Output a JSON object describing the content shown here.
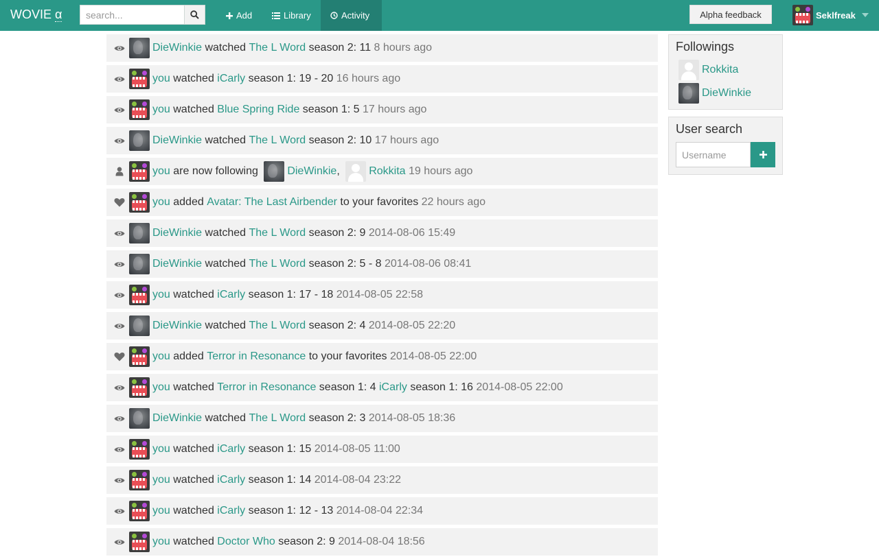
{
  "nav": {
    "brand": "WOVIE",
    "brand_alpha": "α",
    "search_placeholder": "search...",
    "add_label": "Add",
    "library_label": "Library",
    "activity_label": "Activity",
    "feedback_label": "Alpha feedback",
    "username": "Seklfreak"
  },
  "colors": {
    "accent": "#2a9888",
    "accent_dark": "#237f73",
    "row_bg": "#f2f2f2",
    "time": "#777777"
  },
  "feed": [
    {
      "icon": "eye-icon",
      "avatar": "winkie",
      "segs": [
        {
          "t": "DieWinkie",
          "l": true
        },
        {
          "t": " watched "
        },
        {
          "t": "The L Word",
          "l": true
        },
        {
          "t": " season 2: 11 "
        },
        {
          "t": "8 hours ago",
          "time": true
        }
      ]
    },
    {
      "icon": "eye-icon",
      "avatar": "monster",
      "segs": [
        {
          "t": "you",
          "l": true
        },
        {
          "t": " watched "
        },
        {
          "t": "iCarly",
          "l": true
        },
        {
          "t": " season 1: 19 - 20 "
        },
        {
          "t": "16 hours ago",
          "time": true
        }
      ]
    },
    {
      "icon": "eye-icon",
      "avatar": "monster",
      "segs": [
        {
          "t": "you",
          "l": true
        },
        {
          "t": " watched "
        },
        {
          "t": "Blue Spring Ride",
          "l": true
        },
        {
          "t": " season 1: 5 "
        },
        {
          "t": "17 hours ago",
          "time": true
        }
      ]
    },
    {
      "icon": "eye-icon",
      "avatar": "winkie",
      "segs": [
        {
          "t": "DieWinkie",
          "l": true
        },
        {
          "t": " watched "
        },
        {
          "t": "The L Word",
          "l": true
        },
        {
          "t": " season 2: 10 "
        },
        {
          "t": "17 hours ago",
          "time": true
        }
      ]
    },
    {
      "icon": "user-icon",
      "avatar": "monster",
      "segs": [
        {
          "t": "you",
          "l": true
        },
        {
          "t": " are now following "
        },
        {
          "av": "winkie"
        },
        {
          "t": "DieWinkie",
          "l": true
        },
        {
          "t": ", "
        },
        {
          "av": "default"
        },
        {
          "t": "Rokkita",
          "l": true
        },
        {
          "t": " "
        },
        {
          "t": "19 hours ago",
          "time": true
        }
      ]
    },
    {
      "icon": "heart-icon",
      "avatar": "monster",
      "segs": [
        {
          "t": "you",
          "l": true
        },
        {
          "t": " added "
        },
        {
          "t": "Avatar: The Last Airbender",
          "l": true
        },
        {
          "t": " to your favorites "
        },
        {
          "t": "22 hours ago",
          "time": true
        }
      ]
    },
    {
      "icon": "eye-icon",
      "avatar": "winkie",
      "segs": [
        {
          "t": "DieWinkie",
          "l": true
        },
        {
          "t": " watched "
        },
        {
          "t": "The L Word",
          "l": true
        },
        {
          "t": " season 2: 9 "
        },
        {
          "t": "2014-08-06 15:49",
          "time": true
        }
      ]
    },
    {
      "icon": "eye-icon",
      "avatar": "winkie",
      "segs": [
        {
          "t": "DieWinkie",
          "l": true
        },
        {
          "t": " watched "
        },
        {
          "t": "The L Word",
          "l": true
        },
        {
          "t": " season 2: 5 - 8 "
        },
        {
          "t": "2014-08-06 08:41",
          "time": true
        }
      ]
    },
    {
      "icon": "eye-icon",
      "avatar": "monster",
      "segs": [
        {
          "t": "you",
          "l": true
        },
        {
          "t": " watched "
        },
        {
          "t": "iCarly",
          "l": true
        },
        {
          "t": " season 1: 17 - 18 "
        },
        {
          "t": "2014-08-05 22:58",
          "time": true
        }
      ]
    },
    {
      "icon": "eye-icon",
      "avatar": "winkie",
      "segs": [
        {
          "t": "DieWinkie",
          "l": true
        },
        {
          "t": " watched "
        },
        {
          "t": "The L Word",
          "l": true
        },
        {
          "t": " season 2: 4 "
        },
        {
          "t": "2014-08-05 22:20",
          "time": true
        }
      ]
    },
    {
      "icon": "heart-icon",
      "avatar": "monster",
      "segs": [
        {
          "t": "you",
          "l": true
        },
        {
          "t": " added "
        },
        {
          "t": "Terror in Resonance",
          "l": true
        },
        {
          "t": " to your favorites "
        },
        {
          "t": "2014-08-05 22:00",
          "time": true
        }
      ]
    },
    {
      "icon": "eye-icon",
      "avatar": "monster",
      "segs": [
        {
          "t": "you",
          "l": true
        },
        {
          "t": " watched "
        },
        {
          "t": "Terror in Resonance",
          "l": true
        },
        {
          "t": " season 1: 4 "
        },
        {
          "t": "iCarly",
          "l": true
        },
        {
          "t": " season 1: 16 "
        },
        {
          "t": "2014-08-05 22:00",
          "time": true
        }
      ]
    },
    {
      "icon": "eye-icon",
      "avatar": "winkie",
      "segs": [
        {
          "t": "DieWinkie",
          "l": true
        },
        {
          "t": " watched "
        },
        {
          "t": "The L Word",
          "l": true
        },
        {
          "t": " season 2: 3 "
        },
        {
          "t": "2014-08-05 18:36",
          "time": true
        }
      ]
    },
    {
      "icon": "eye-icon",
      "avatar": "monster",
      "segs": [
        {
          "t": "you",
          "l": true
        },
        {
          "t": " watched "
        },
        {
          "t": "iCarly",
          "l": true
        },
        {
          "t": " season 1: 15 "
        },
        {
          "t": "2014-08-05 11:00",
          "time": true
        }
      ]
    },
    {
      "icon": "eye-icon",
      "avatar": "monster",
      "segs": [
        {
          "t": "you",
          "l": true
        },
        {
          "t": " watched "
        },
        {
          "t": "iCarly",
          "l": true
        },
        {
          "t": " season 1: 14 "
        },
        {
          "t": "2014-08-04 23:22",
          "time": true
        }
      ]
    },
    {
      "icon": "eye-icon",
      "avatar": "monster",
      "segs": [
        {
          "t": "you",
          "l": true
        },
        {
          "t": " watched "
        },
        {
          "t": "iCarly",
          "l": true
        },
        {
          "t": " season 1: 12 - 13 "
        },
        {
          "t": "2014-08-04 22:34",
          "time": true
        }
      ]
    },
    {
      "icon": "eye-icon",
      "avatar": "monster",
      "segs": [
        {
          "t": "you",
          "l": true
        },
        {
          "t": " watched "
        },
        {
          "t": "Doctor Who",
          "l": true
        },
        {
          "t": " season 2: 9 "
        },
        {
          "t": "2014-08-04 18:56",
          "time": true
        }
      ]
    }
  ],
  "followings": {
    "title": "Followings",
    "users": [
      {
        "name": "Rokkita",
        "avatar": "default"
      },
      {
        "name": "DieWinkie",
        "avatar": "winkie"
      }
    ]
  },
  "user_search": {
    "title": "User search",
    "placeholder": "Username"
  }
}
